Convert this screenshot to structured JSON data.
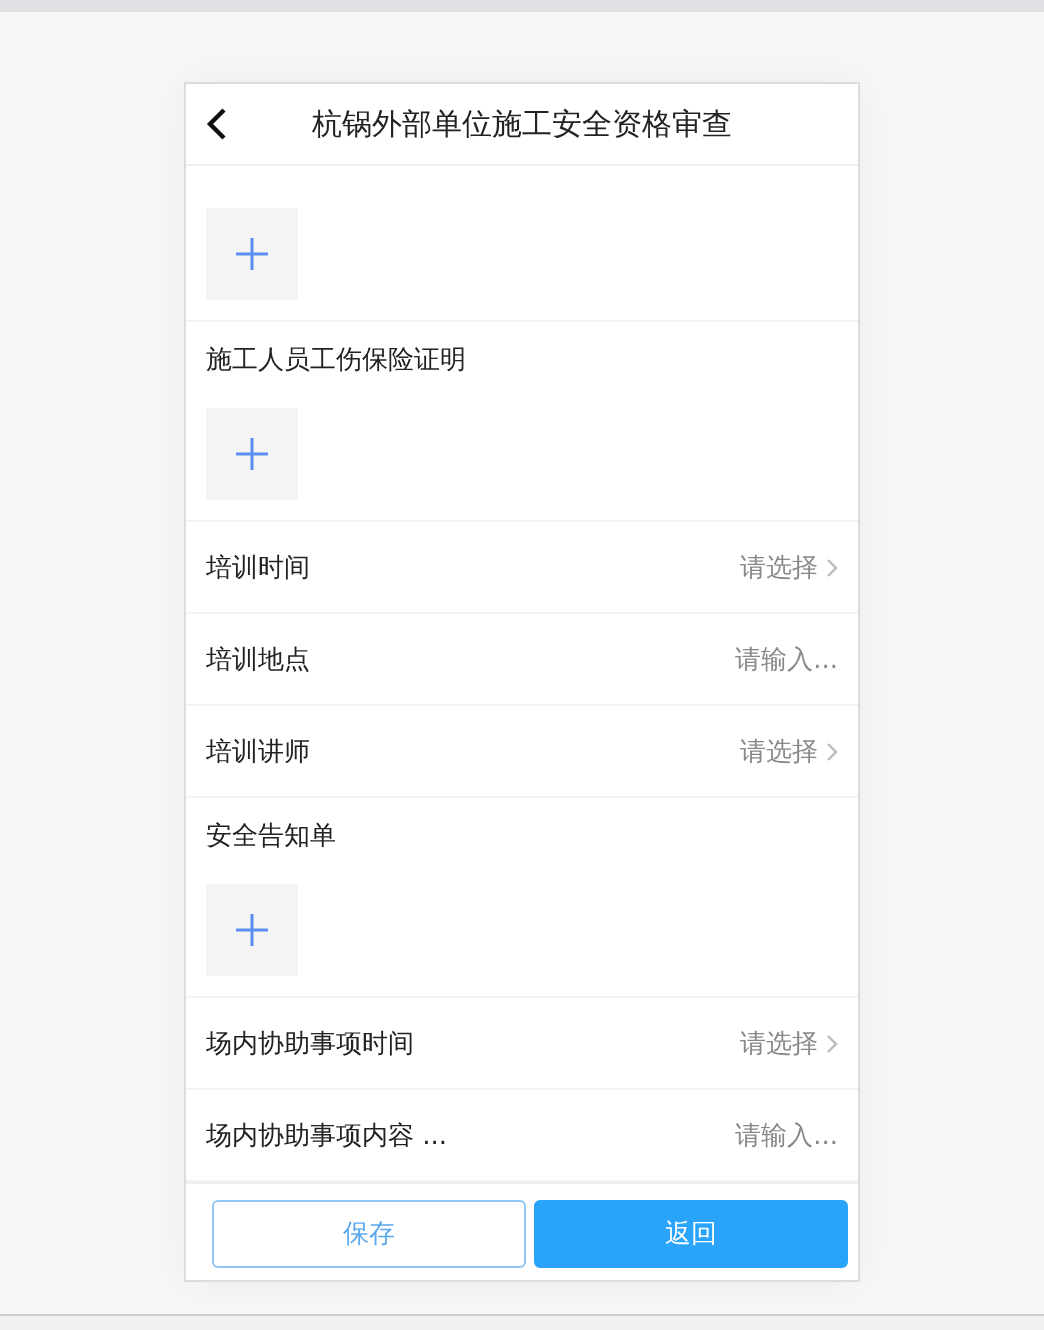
{
  "header": {
    "title": "杭锅外部单位施工安全资格审查"
  },
  "fields": [
    {
      "kind": "upload"
    },
    {
      "kind": "upload",
      "label": "施工人员工伤保险证明"
    },
    {
      "kind": "select",
      "label": "培训时间",
      "placeholder": "请选择"
    },
    {
      "kind": "input",
      "label": "培训地点",
      "placeholder": "请输入..."
    },
    {
      "kind": "select",
      "label": "培训讲师",
      "placeholder": "请选择"
    },
    {
      "kind": "upload",
      "label": "安全告知单"
    },
    {
      "kind": "select",
      "label": "场内协助事项时间",
      "placeholder": "请选择"
    },
    {
      "kind": "input",
      "label": "场内协助事项内容 ...",
      "placeholder": "请输入..."
    }
  ],
  "buttons": [
    {
      "label": "保存",
      "kind": "secondary"
    },
    {
      "label": "返回",
      "kind": "primary"
    }
  ]
}
